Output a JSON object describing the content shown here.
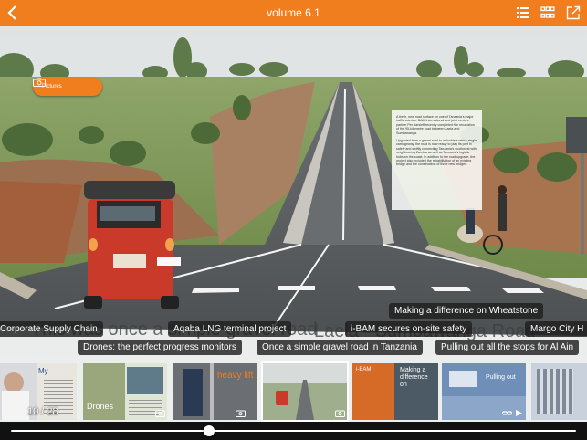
{
  "header": {
    "title": "volume 6.1",
    "back_icon": "chevron-left-icon",
    "icons": [
      "list-icon",
      "grid-icon",
      "share-icon"
    ],
    "bar_color": "#f07d1e"
  },
  "article": {
    "pictures_label": "Pictures",
    "textbox_paragraphs": [
      "A fresh, new road surface on one of Tanzania's major traffic arteries: BAM International and joint venture partner Per Aarsleff recently completed the renovation of the 95-kilometre road between Laela and Sumbawanga.",
      "Upgraded from a gravel road to a double-surface single carriageway, the road is now ready to play its part in safely and swiftly connecting Tanzania's southwest with neighbouring Zambia as well as Tanzania's logistic hubs on the coast. In addition to the road upgrade, the project also included the rehabilitation of an existing bridge and the construction of three new bridges."
    ],
    "caption_left": "This was once a simple gravel road",
    "caption_right": "Laela - Sumbawanga Road"
  },
  "labels": {
    "row1": [
      "Corporate Supply Chain",
      "Aqaba LNG terminal project",
      "i-BAM secures on-site safety",
      "Margo City H"
    ],
    "row1_top": "Making a difference on Wheatstone",
    "row2": [
      "Drones: the perfect progress monitors",
      "Once a simple gravel road in Tanzania",
      "Pulling out all the stops for Al Ain"
    ]
  },
  "thumbnails": {
    "page_indicator": "10 / 28",
    "items": [
      {
        "name": "thumb-corporate",
        "text": "My"
      },
      {
        "name": "thumb-drones",
        "text": "Drones"
      },
      {
        "name": "thumb-heavy-lift",
        "text": "heavy lift"
      },
      {
        "name": "thumb-gravel-road",
        "text": ""
      },
      {
        "name": "thumb-ibam",
        "text": "i-BAM"
      },
      {
        "name": "thumb-wheatstone",
        "text": "Making a difference on"
      },
      {
        "name": "thumb-al-ain",
        "text": "Pulling out"
      },
      {
        "name": "thumb-margo",
        "text": ""
      }
    ]
  },
  "slider": {
    "position": 0.35
  }
}
